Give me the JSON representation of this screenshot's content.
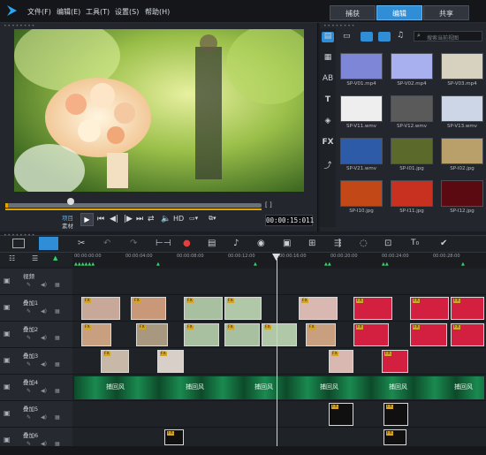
{
  "menu": {
    "file": "文件(F)",
    "edit": "编辑(E)",
    "tools": "工具(T)",
    "settings": "设置(S)",
    "help": "帮助(H)"
  },
  "tabs": {
    "capture": "捕获",
    "edit": "编辑",
    "share": "共享"
  },
  "playback": {
    "project_label": "项目",
    "clip_label": "素材",
    "hd": "HD",
    "timecode": "00:00:15:011"
  },
  "library": {
    "search_placeholder": "搜索当前视图",
    "thumbs": [
      {
        "label": "SP-V01.mp4",
        "bg": "#7e86d8"
      },
      {
        "label": "SP-V02.mp4",
        "bg": "#a9b0f0"
      },
      {
        "label": "SP-V03.mp4",
        "bg": "#d7d2c0"
      },
      {
        "label": "SP-V11.wmv",
        "bg": "#eeeeee"
      },
      {
        "label": "SP-V12.wmv",
        "bg": "#5a5a5a"
      },
      {
        "label": "SP-V13.wmv",
        "bg": "#cdd6e6"
      },
      {
        "label": "SP-V21.wmv",
        "bg": "#2d5ba8"
      },
      {
        "label": "SP-I01.jpg",
        "bg": "#5b6a2a"
      },
      {
        "label": "SP-I02.jpg",
        "bg": "#b9a06a"
      },
      {
        "label": "SP-I10.jpg",
        "bg": "#c24818"
      },
      {
        "label": "SP-I11.jpg",
        "bg": "#c83020"
      },
      {
        "label": "SP-I12.jpg",
        "bg": "#5a0a10"
      }
    ]
  },
  "ruler": [
    "00:00:00:00",
    "00:00:04:00",
    "00:00:08:00",
    "00:00:12:00",
    "00:00:16:00",
    "00:00:20:00",
    "00:00:24:00",
    "00:00:28:00"
  ],
  "tracks": [
    "视频",
    "叠加1",
    "叠加2",
    "叠加3",
    "叠加4",
    "叠加5",
    "叠加6"
  ],
  "track4_text": "捕回风",
  "fx_badge": "FX"
}
